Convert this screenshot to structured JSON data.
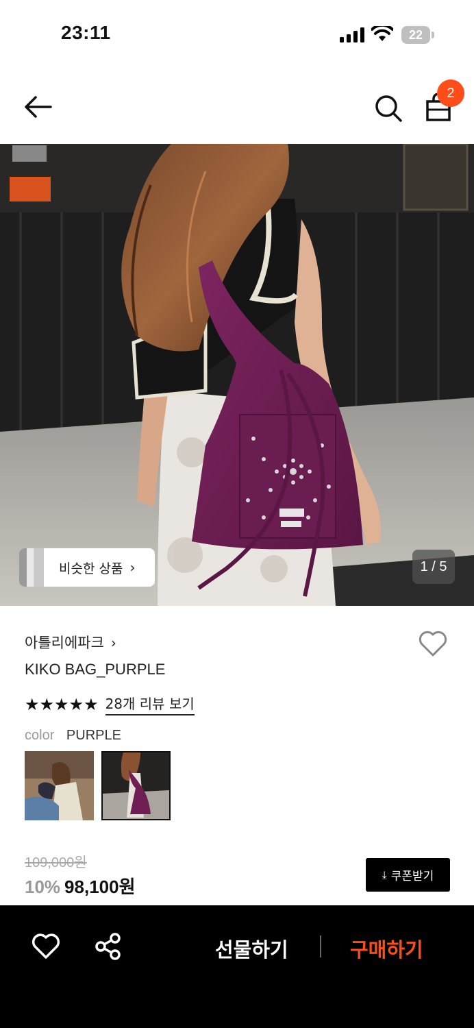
{
  "status_bar": {
    "time": "23:11",
    "battery": "22"
  },
  "header": {
    "cart_count": "2"
  },
  "hero": {
    "similar_label": "비슷한 상품",
    "pager": "1 / 5"
  },
  "product": {
    "brand": "아틀리에파크",
    "name": "KIKO BAG_PURPLE",
    "stars": "★★★★★",
    "rating": 5,
    "review_link": "28개 리뷰 보기",
    "option_label": "color",
    "option_value": "PURPLE",
    "original_price": "109,000원",
    "discount": "10%",
    "sale_price": "98,100원",
    "coupon_label": "쿠폰받기"
  },
  "bottom_bar": {
    "gift_label": "선물하기",
    "buy_label": "구매하기"
  },
  "colors": {
    "accent": "#ff4d1a",
    "bag_purple": "#6e1e52",
    "bottom_bar": "#000000"
  },
  "icons": [
    "back-arrow-icon",
    "search-icon",
    "shopping-bag-icon",
    "heart-icon",
    "share-icon",
    "download-icon",
    "chevron-right-icon"
  ]
}
